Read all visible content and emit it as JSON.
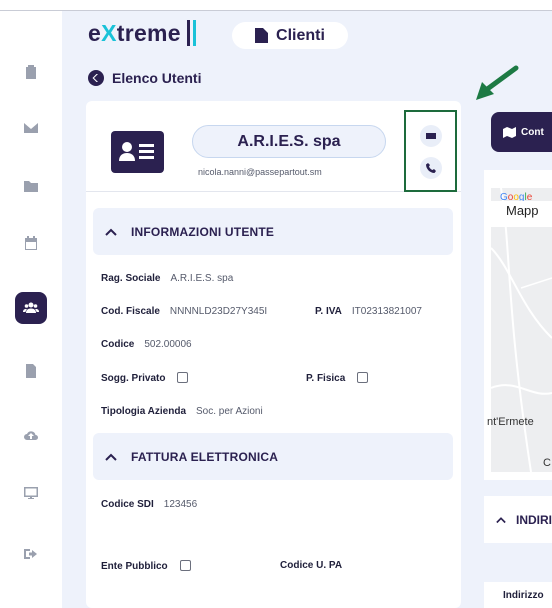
{
  "app": {
    "logo_prefix": "e",
    "logo_x": "X",
    "logo_suffix": "treme",
    "page_title": "Clienti",
    "back_label": "Elenco Utenti"
  },
  "sidebar": {
    "items": [
      {
        "icon": "clipboard-icon",
        "active": false
      },
      {
        "icon": "envelope-icon",
        "active": false
      },
      {
        "icon": "folder-icon",
        "active": false
      },
      {
        "icon": "calendar-icon",
        "active": false
      },
      {
        "icon": "users-icon",
        "active": true
      },
      {
        "icon": "document-icon",
        "active": false
      },
      {
        "icon": "cloud-upload-icon",
        "active": false
      },
      {
        "icon": "monitor-icon",
        "active": false
      },
      {
        "icon": "sign-out-icon",
        "active": false
      }
    ]
  },
  "customer": {
    "name": "A.R.I.E.S. spa",
    "email": "nicola.nanni@passepartout.sm"
  },
  "sections": {
    "info_title": "INFORMAZIONI UTENTE",
    "fattura_title": "FATTURA ELETTRONICA"
  },
  "info": {
    "rag_sociale_label": "Rag. Sociale",
    "rag_sociale_value": "A.R.I.E.S. spa",
    "cod_fiscale_label": "Cod. Fiscale",
    "cod_fiscale_value": "NNNNLD23D27Y345I",
    "piva_label": "P. IVA",
    "piva_value": "IT02313821007",
    "codice_label": "Codice",
    "codice_value": "502.00006",
    "sogg_privato_label": "Sogg. Privato",
    "pfisica_label": "P. Fisica",
    "tipologia_label": "Tipologia Azienda",
    "tipologia_value": "Soc. per Azioni"
  },
  "fattura": {
    "codice_sdi_label": "Codice SDI",
    "codice_sdi_value": "123456",
    "ente_pubblico_label": "Ente Pubblico",
    "codice_upa_label": "Codice U. PA"
  },
  "right": {
    "button_label": "Cont",
    "map_tab": "Mapp",
    "map_place": "nt'Ermete",
    "map_place2": "C",
    "section_title": "INDIRI",
    "bottom_label": "Indirizzo"
  },
  "colors": {
    "primary": "#2b2150",
    "accent": "#19c2d8",
    "annotation": "#1d6b3c"
  }
}
